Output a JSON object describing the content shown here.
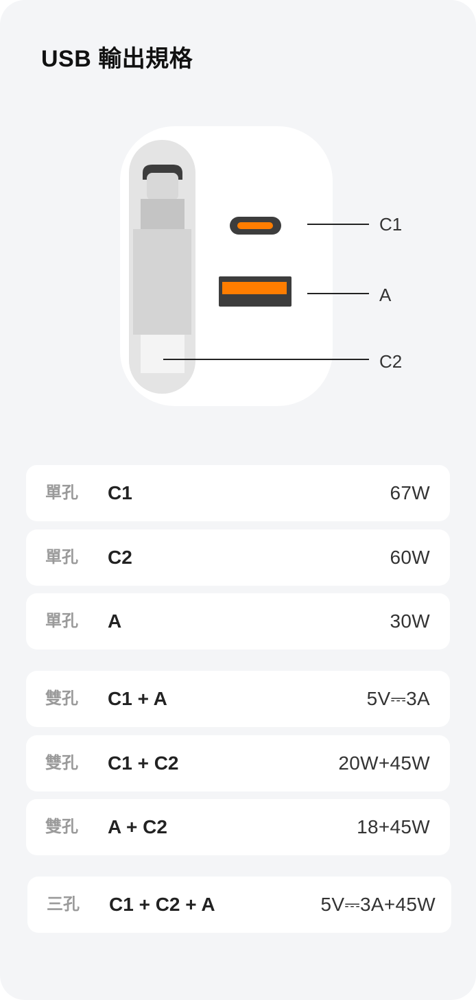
{
  "header": {
    "title": "USB 輸出規格"
  },
  "diagram": {
    "ports": [
      {
        "id": "c1",
        "label": "C1",
        "icon": "usb-c-port-icon"
      },
      {
        "id": "a",
        "label": "A",
        "icon": "usb-a-port-icon"
      },
      {
        "id": "c2",
        "label": "C2",
        "icon": "usb-c-cable-icon"
      }
    ],
    "colors": {
      "accent": "#ff7d00",
      "port_body": "#3d3d3d",
      "charger_body": "#ffffff",
      "cable_track": "#e4e4e4",
      "cable": "#d4d4d4",
      "cable_neck": "#c4c4c4"
    }
  },
  "specs": [
    {
      "type": "單孔",
      "port": "C1",
      "power": "67W"
    },
    {
      "type": "單孔",
      "port": "C2",
      "power": "60W"
    },
    {
      "type": "單孔",
      "port": "A",
      "power": "30W"
    },
    {
      "type": "雙孔",
      "port": "C1 + A",
      "power": "5V⎓3A"
    },
    {
      "type": "雙孔",
      "port": "C1 + C2",
      "power": "20W+45W"
    },
    {
      "type": "雙孔",
      "port": "A + C2",
      "power": "18+45W"
    },
    {
      "type": "三孔",
      "port": "C1 + C2 + A",
      "power": "5V⎓3A+45W"
    }
  ]
}
